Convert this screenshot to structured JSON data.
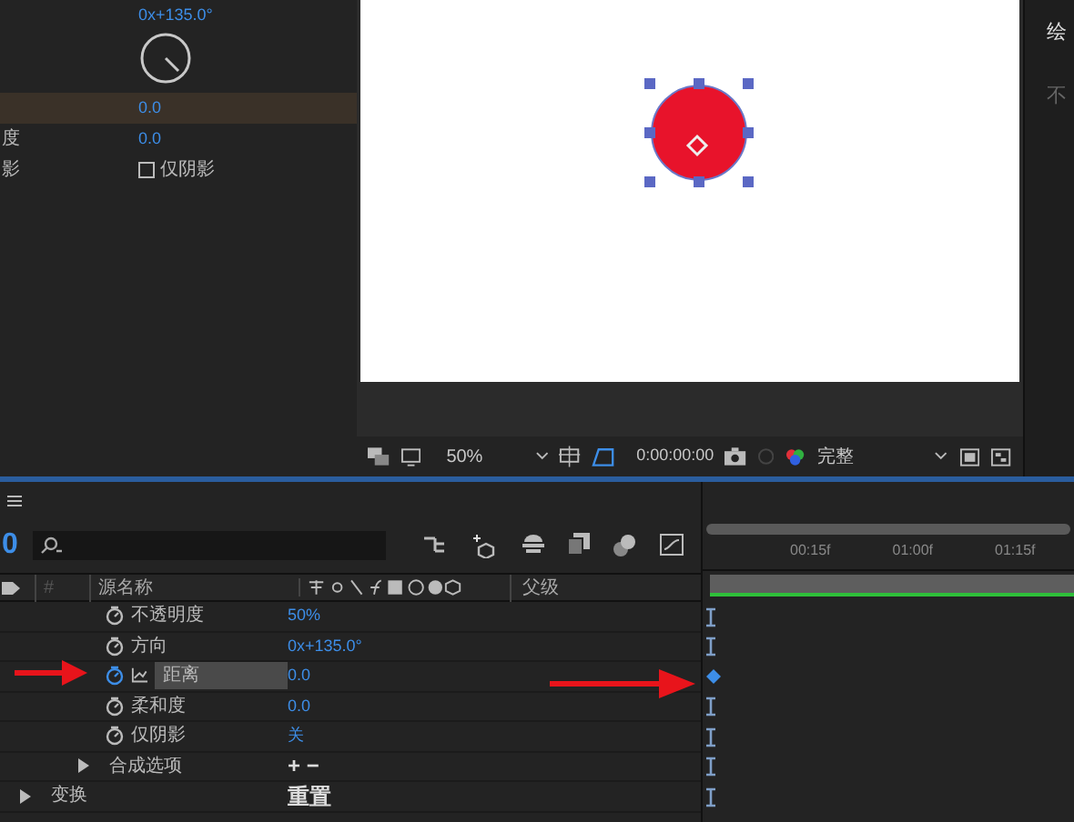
{
  "effect_controls": {
    "direction_value": "0x+135.0°",
    "rows": [
      {
        "kind": "value",
        "label": "",
        "value": "0.0",
        "selected": true
      },
      {
        "kind": "value",
        "label": "度",
        "value": "0.0",
        "selected": false
      },
      {
        "kind": "checkbox",
        "label": "影",
        "checkbox_label": "仅阴影",
        "checked": false,
        "selected": false
      }
    ]
  },
  "viewer": {
    "zoom": "50%",
    "timecode": "0:00:00:00",
    "resolution": "完整"
  },
  "right_panel": {
    "title": "绘",
    "text": "不"
  },
  "timeline": {
    "timecode": "0",
    "columns": [
      "#",
      "源名称",
      "父级"
    ],
    "ruler": [
      "00:15f",
      "01:00f",
      "01:15f"
    ],
    "effect_rows": [
      {
        "kind": "property",
        "name": "不透明度",
        "value": "50%",
        "animated": false,
        "selected": false
      },
      {
        "kind": "property",
        "name": "方向",
        "value": "0x+135.0°",
        "animated": false,
        "selected": false
      },
      {
        "kind": "property",
        "name": "距离",
        "value": "0.0",
        "animated": true,
        "selected": true
      },
      {
        "kind": "property",
        "name": "柔和度",
        "value": "0.0",
        "animated": false,
        "selected": false
      },
      {
        "kind": "property",
        "name": "仅阴影",
        "value": "关",
        "animated": false,
        "selected": false
      },
      {
        "kind": "group",
        "name": "合成选项",
        "value": "+ −",
        "expanded": false,
        "selected": false
      }
    ],
    "layer_rows": [
      {
        "kind": "group",
        "name": "变换",
        "value": "重置",
        "expanded": false,
        "selected": false
      }
    ]
  }
}
